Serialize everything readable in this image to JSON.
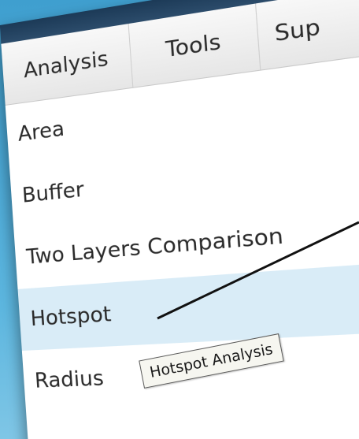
{
  "menubar": {
    "tabs": [
      {
        "label": "Analysis"
      },
      {
        "label": "Tools"
      },
      {
        "label": "Sup"
      }
    ]
  },
  "menu": {
    "items": [
      {
        "label": "Area"
      },
      {
        "label": "Buffer"
      },
      {
        "label": "Two Layers Comparison"
      },
      {
        "label": "Hotspot"
      },
      {
        "label": "Radius"
      }
    ],
    "highlighted_item": "Hotspot"
  },
  "tooltip": {
    "text": "Hotspot Analysis"
  },
  "colors": {
    "background_top": "#3f9fcf",
    "background_bottom": "#7fc6e6",
    "panel_header": "#1c3a57",
    "hover_row": "#d9ecf7",
    "tooltip_bg": "#f6f6f0"
  }
}
